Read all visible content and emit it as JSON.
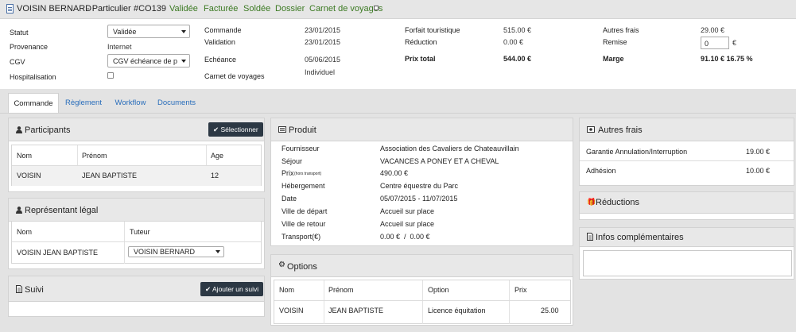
{
  "header": {
    "name": "VOISIN BERNARD",
    "type": "- Particulier",
    "code": "#CO139",
    "statuses": [
      "Validée",
      "Facturée",
      "Soldée",
      "Dossier",
      "Carnet de voyages"
    ]
  },
  "info": {
    "col1": {
      "statut_label": "Statut",
      "statut_value": "Validée",
      "provenance_label": "Provenance",
      "provenance_value": "Internet",
      "cgv_label": "CGV",
      "cgv_value": "CGV échéance de p",
      "hospitalisation_label": "Hospitalisation"
    },
    "col2": {
      "commande_label": "Commande",
      "commande_value": "23/01/2015",
      "validation_label": "Validation",
      "validation_value": "23/01/2015",
      "echeance_label": "Echéance",
      "echeance_value": "05/06/2015",
      "carnet_label": "Carnet de voyages",
      "carnet_value": "Individuel"
    },
    "col3": {
      "forfait_label": "Forfait touristique",
      "forfait_value": "515.00 €",
      "reduction_label": "Réduction",
      "reduction_value": "0.00 €",
      "prix_total_label": "Prix total",
      "prix_total_value": "544.00 €"
    },
    "col4": {
      "autres_label": "Autres frais",
      "autres_value": "29.00 €",
      "remise_label": "Remise",
      "remise_value": "0",
      "remise_unit": "€",
      "marge_label": "Marge",
      "marge_value": "91.10 € 16.75 %"
    }
  },
  "tabs": [
    "Commande",
    "Règlement",
    "Workflow",
    "Documents"
  ],
  "participants": {
    "title": "Participants",
    "button": "Sélectionner",
    "headers": [
      "Nom",
      "Prénom",
      "Age"
    ],
    "rows": [
      {
        "nom": "VOISIN",
        "prenom": "JEAN BAPTISTE",
        "age": "12"
      }
    ]
  },
  "representant": {
    "title": "Représentant légal",
    "headers": [
      "Nom",
      "Tuteur"
    ],
    "row": {
      "nom": "VOISIN JEAN BAPTISTE",
      "tuteur": "VOISIN BERNARD"
    }
  },
  "suivi": {
    "title": "Suivi",
    "button": "Ajouter un suivi"
  },
  "produit": {
    "title": "Produit",
    "fields": [
      {
        "label": "Fournisseur",
        "note": "",
        "value": "Association des Cavaliers de Chateauvillain"
      },
      {
        "label": "Séjour",
        "note": "",
        "value": "VACANCES A PONEY ET A CHEVAL"
      },
      {
        "label": "Prix",
        "note": "(hors transport)",
        "value": "490.00 €"
      },
      {
        "label": "Hébergement",
        "note": "",
        "value": "Centre équestre du Parc"
      },
      {
        "label": "Date",
        "note": "",
        "value": "05/07/2015 - 11/07/2015"
      },
      {
        "label": "Ville de départ",
        "note": "",
        "value": "Accueil sur place"
      },
      {
        "label": "Ville de retour",
        "note": "",
        "value": "Accueil sur place"
      },
      {
        "label": "Transport(€)",
        "note": "",
        "value": "0.00 €  /  0.00 €"
      }
    ]
  },
  "options": {
    "title": "Options",
    "headers": [
      "Nom",
      "Prénom",
      "Option",
      "Prix"
    ],
    "row": {
      "nom": "VOISIN",
      "prenom": "JEAN BAPTISTE",
      "option": "Licence équitation",
      "prix": "25.00"
    }
  },
  "autres_frais": {
    "title": "Autres frais",
    "rows": [
      {
        "label": "Garantie Annulation/Interruption",
        "value": "19.00 €"
      },
      {
        "label": "Adhésion",
        "value": "10.00 €"
      }
    ]
  },
  "reductions": {
    "title": "Réductions"
  },
  "infos": {
    "title": "Infos complémentaires"
  },
  "colors": {
    "accent_green": "#3c7a23",
    "link_blue": "#2a6ebb",
    "button_dark": "#2c3844"
  }
}
